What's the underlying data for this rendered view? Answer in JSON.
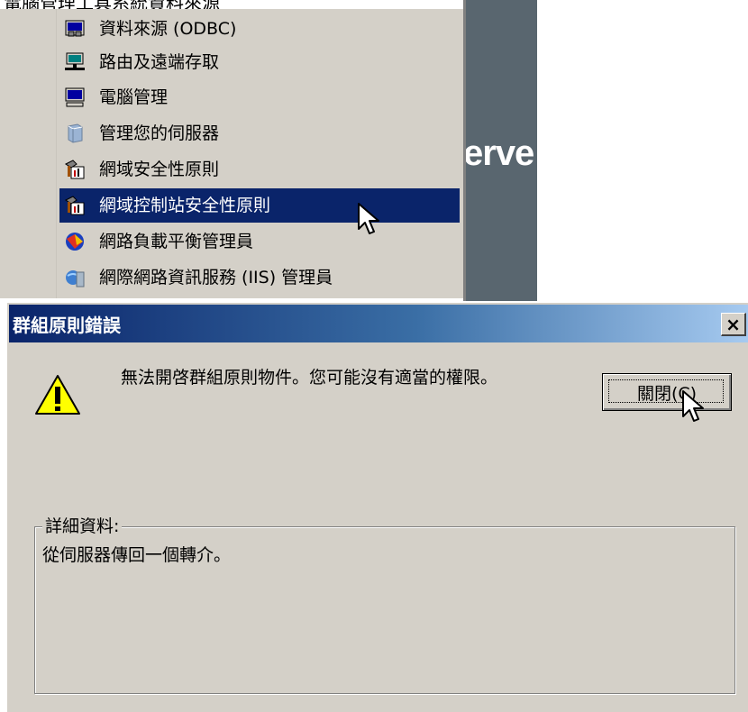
{
  "top_strip": {
    "text": "電腦管理工具系統資料來源"
  },
  "menu": {
    "items": [
      {
        "label": "資料來源 (ODBC)",
        "icon": "odbc-data-sources-icon",
        "active": false
      },
      {
        "label": "路由及遠端存取",
        "icon": "routing-remote-access-icon",
        "active": false
      },
      {
        "label": "電腦管理",
        "icon": "computer-management-icon",
        "active": false
      },
      {
        "label": "管理您的伺服器",
        "icon": "manage-server-icon",
        "active": false
      },
      {
        "label": "網域安全性原則",
        "icon": "domain-security-policy-icon",
        "active": false
      },
      {
        "label": "網域控制站安全性原則",
        "icon": "dc-security-policy-icon",
        "active": true
      },
      {
        "label": "網路負載平衡管理員",
        "icon": "network-load-balancing-icon",
        "active": false
      },
      {
        "label": "網際網路資訊服務 (IIS) 管理員",
        "icon": "iis-manager-icon",
        "active": false
      }
    ]
  },
  "banner": {
    "text": "erve"
  },
  "dialog": {
    "title": "群組原則錯誤",
    "close_glyph": "×",
    "message": "無法開啓群組原則物件。您可能沒有適當的權限。",
    "close_button_label": "關閉(C)",
    "details_label": "詳細資料:",
    "details_text": "從伺服器傳回一個轉介。"
  },
  "colors": {
    "menu_bg": "#d4d0c8",
    "highlight": "#0a246a",
    "title_gradient_start": "#0a246a",
    "title_gradient_end": "#a6caf0",
    "banner_bg": "#59666f"
  }
}
